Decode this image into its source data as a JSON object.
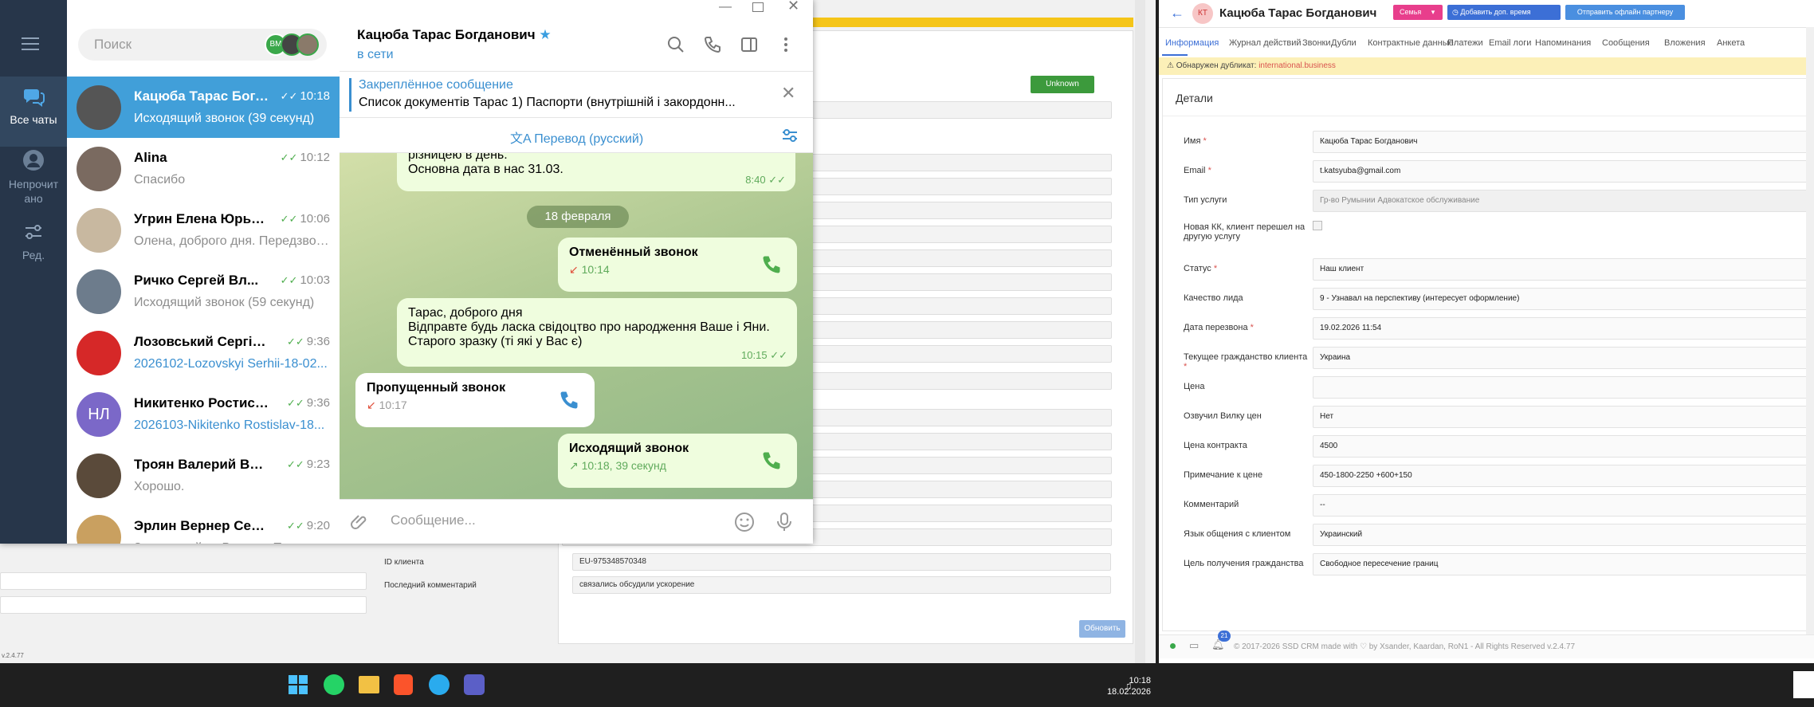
{
  "background_crm": {
    "unknown_btn": "Unknown",
    "client_id_label": "ID клиента",
    "client_id_value": "EU-975348570348",
    "last_comment_label": "Последний комментарий",
    "last_comment_value": "связались обсудили ускорение",
    "update_btn": "Обновить",
    "version": "v.2.4.77"
  },
  "telegram": {
    "nav": {
      "all_chats": "Все чаты",
      "unread": "Непрочитано",
      "edit": "Ред."
    },
    "search_placeholder": "Поиск",
    "search_avatar_initials": "ВМ",
    "chats": [
      {
        "name": "Кацюба Тарас Богдан...",
        "time": "10:18",
        "preview": "Исходящий звонок (39 секунд)",
        "color": "#555555"
      },
      {
        "name": "Alina",
        "time": "10:12",
        "preview": "Спасибо",
        "color": "#7a6a60"
      },
      {
        "name": "Угрин Елена Юрьевна",
        "time": "10:06",
        "preview": "Олена, доброго дня. Передзвон...",
        "color": "#c8b8a0"
      },
      {
        "name": "Ричко Сергей Вл...",
        "time": "10:03",
        "preview": "Исходящий звонок (59 секунд)",
        "color": "#6d7c8c"
      },
      {
        "name": "Лозовський Сергій...",
        "time": "9:36",
        "preview": "2026102-Lozovskyi Serhii-18-02...",
        "color": "#d62828"
      },
      {
        "name": "Никитенко Ростислав...",
        "time": "9:36",
        "preview": "2026103-Nikitenko Rostislav-18...",
        "color": "#7b68c8",
        "initials": "НЛ"
      },
      {
        "name": "Троян Валерий Валенти...",
        "time": "9:23",
        "preview": "Хорошо.",
        "color": "#5a4a3a"
      },
      {
        "name": "Эрлин Вернер Сергее...",
        "time": "9:20",
        "preview": "Здравствуйте, Вернер. Подан...",
        "color": "#c9a060"
      }
    ],
    "conversation": {
      "title": "Кацюба Тарас Богданович",
      "status": "в сети",
      "pinned_title": "Закреплённое сообщение",
      "pinned_text": "Список документів Тарас  1) Паспорти (внутрішній і закордонн...",
      "translate": "Перевод (русский)",
      "msg_top_line1": "різницею в день.",
      "msg_top_line2": "Основна дата в нас 31.03.",
      "msg_top_time": "8:40",
      "date_pill": "18 февраля",
      "cancelled_call": "Отменённый звонок",
      "cancelled_call_time": "10:14",
      "msg2_line1": "Тарас, доброго дня",
      "msg2_line2": "Відправте будь ласка свідоцтво про народження Ваше і Яни.",
      "msg2_line3": "Старого зразку (ті які у Вас є)",
      "msg2_time": "10:15",
      "missed_call": "Пропущенный звонок",
      "missed_call_time": "10:17",
      "outgoing_call": "Исходящий звонок",
      "outgoing_call_time": "10:18, 39 секунд",
      "composer_placeholder": "Сообщение..."
    }
  },
  "crm": {
    "initials": "КТ",
    "title": "Кацюба Тарас Богданович",
    "family_btn": "Семья",
    "add_time_btn": "Добавить доп. время",
    "offline_btn": "Отправить офлайн партнеру",
    "tabs": [
      "Информация",
      "Журнал действий",
      "Звонки",
      "Дубли",
      "Контрактные данные",
      "Платежи",
      "Email логи",
      "Напоминания",
      "Сообщения",
      "Вложения",
      "Анкета"
    ],
    "duplicate_label": "Обнаружен дубликат:",
    "duplicate_value": "international.business",
    "details_title": "Детали",
    "fields": [
      {
        "label": "Имя",
        "req": "*",
        "value": "Кацюба Тарас Богданович"
      },
      {
        "label": "Email",
        "req": "*",
        "value": "t.katsyuba@gmail.com"
      },
      {
        "label": "Тип услуги",
        "req": "",
        "value": "Гр-во Румынии Адвокатское обслуживание"
      },
      {
        "label": "Новая КК, клиент перешел на другую услугу",
        "req": "",
        "value": ""
      },
      {
        "label": "Статус",
        "req": "*",
        "value": "Наш клиент"
      },
      {
        "label": "Качество лида",
        "req": "",
        "value": "9 - Узнавал на перспективу (интересует оформление)"
      },
      {
        "label": "Дата перезвона",
        "req": "*",
        "value": "19.02.2026 11:54"
      },
      {
        "label": "Текущее гражданство клиента",
        "req": "*",
        "value": "Украина"
      },
      {
        "label": "Цена",
        "req": "",
        "value": ""
      },
      {
        "label": "Озвучил Вилку цен",
        "req": "",
        "value": "Нет"
      },
      {
        "label": "Цена контракта",
        "req": "",
        "value": "4500"
      },
      {
        "label": "Примечание к цене",
        "req": "",
        "value": "450-1800-2250 +600+150"
      },
      {
        "label": "Комментарий",
        "req": "",
        "value": "--"
      },
      {
        "label": "Язык общения с клиентом",
        "req": "",
        "value": "Украинский"
      },
      {
        "label": "Цель получения гражданства",
        "req": "",
        "value": "Свободное пересечение границ"
      }
    ],
    "notif_count": "21",
    "footer": "© 2017-2026 SSD CRM made with ♡ by Xsander, Kaardan, RoN1 - All Rights Reserved v.2.4.77"
  },
  "taskbar": {
    "time": "10:18",
    "date": "18.02.2026"
  }
}
